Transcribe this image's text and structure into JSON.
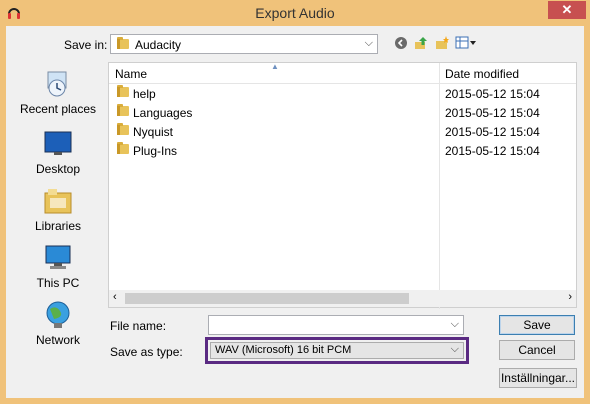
{
  "window": {
    "title": "Export Audio",
    "close_glyph": "✕"
  },
  "toolbar": {
    "save_in_label": "Save in:",
    "save_in_value": "Audacity",
    "icons": [
      "back-icon",
      "up-folder-icon",
      "new-folder-icon",
      "view-menu-icon"
    ]
  },
  "places": [
    {
      "label": "Recent places",
      "icon": "recent-places-icon"
    },
    {
      "label": "Desktop",
      "icon": "desktop-icon"
    },
    {
      "label": "Libraries",
      "icon": "libraries-icon"
    },
    {
      "label": "This PC",
      "icon": "this-pc-icon"
    },
    {
      "label": "Network",
      "icon": "network-icon"
    }
  ],
  "list": {
    "columns": {
      "name": "Name",
      "date": "Date modified"
    },
    "rows": [
      {
        "name": "help",
        "date": "2015-05-12 15:04"
      },
      {
        "name": "Languages",
        "date": "2015-05-12 15:04"
      },
      {
        "name": "Nyquist",
        "date": "2015-05-12 15:04"
      },
      {
        "name": "Plug-Ins",
        "date": "2015-05-12 15:04"
      }
    ]
  },
  "form": {
    "file_name_label": "File name:",
    "file_name_value": "",
    "save_as_type_label": "Save as type:",
    "save_as_type_value": "WAV (Microsoft) 16 bit PCM"
  },
  "buttons": {
    "save": "Save",
    "cancel": "Cancel",
    "settings": "Inställningar..."
  },
  "colors": {
    "title_bar": "#f0c27a",
    "highlight_border": "#5a2a82"
  }
}
